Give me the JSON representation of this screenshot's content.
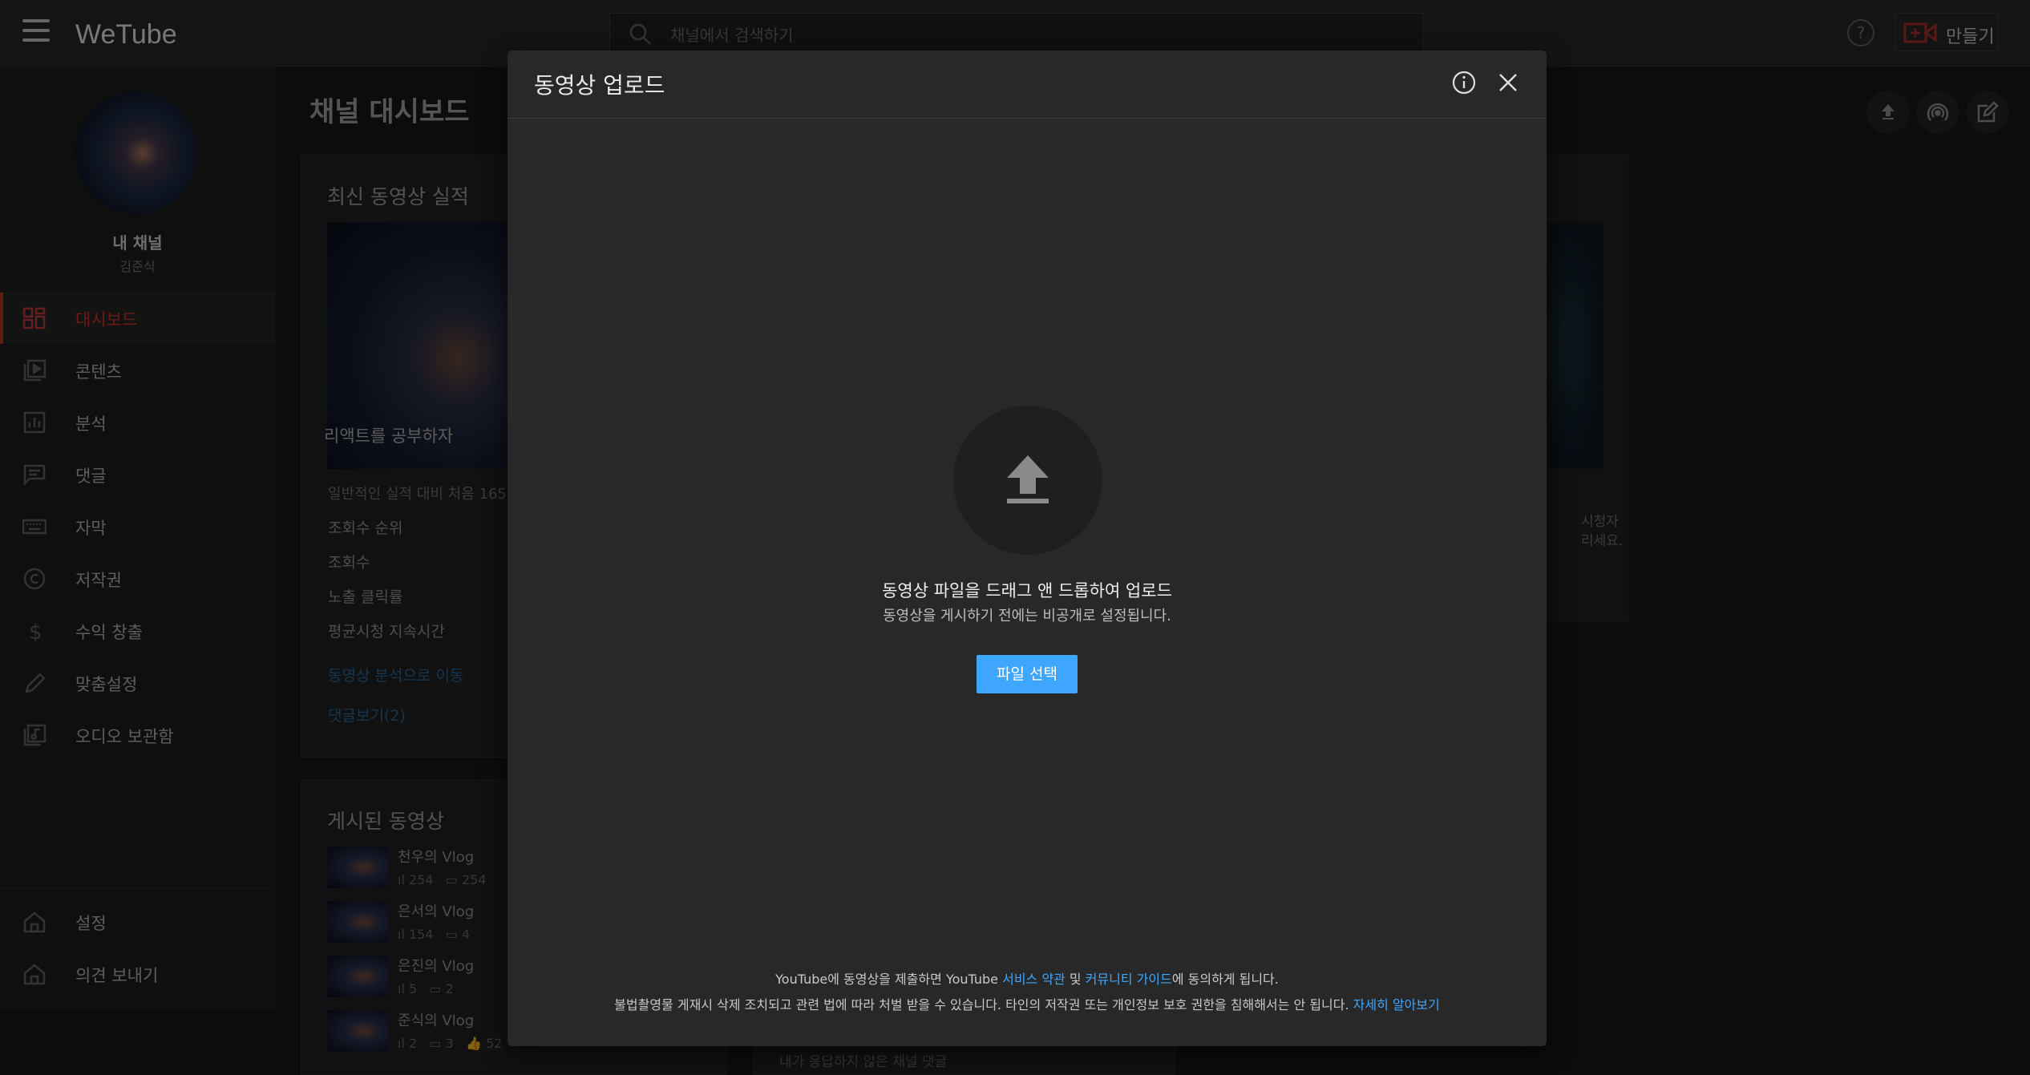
{
  "app": {
    "logo": "WeTube"
  },
  "search": {
    "placeholder": "채널에서 검색하기"
  },
  "header": {
    "help_icon": "?",
    "create_label": "만들기"
  },
  "sidebar": {
    "channel_name": "내 채널",
    "channel_user": "김준식",
    "items": [
      {
        "label": "대시보드",
        "icon": "dashboard-icon",
        "active": true
      },
      {
        "label": "콘텐츠",
        "icon": "content-icon"
      },
      {
        "label": "분석",
        "icon": "analytics-icon"
      },
      {
        "label": "댓글",
        "icon": "comment-icon"
      },
      {
        "label": "자막",
        "icon": "subtitles-icon"
      },
      {
        "label": "저작권",
        "icon": "copyright-icon"
      },
      {
        "label": "수익 창출",
        "icon": "dollar-icon"
      },
      {
        "label": "맞춤설정",
        "icon": "pencil-icon"
      },
      {
        "label": "오디오 보관함",
        "icon": "audio-library-icon"
      }
    ],
    "bottom_items": [
      {
        "label": "설정",
        "icon": "settings-icon"
      },
      {
        "label": "의견 보내기",
        "icon": "feedback-icon"
      }
    ]
  },
  "dashboard": {
    "title": "채널 대시보드",
    "latest": {
      "title": "최신 동영상 실적",
      "video_caption": "리액트를 공부하자",
      "note": "일반적인 실적 대비 처음 165",
      "rows": [
        "조회수 순위",
        "조회수",
        "노출 클릭률",
        "평균시청 지속시간"
      ],
      "analytics_link": "동영상 분석으로 이동",
      "comments_link": "댓글보기(2)"
    },
    "right_card_text": [
      "시청자",
      "리세요."
    ],
    "published": {
      "title": "게시된 동영상",
      "videos": [
        {
          "title": "천우의 Vlog",
          "views": "254",
          "comments": "254",
          "likes": ""
        },
        {
          "title": "은서의 Vlog",
          "views": "154",
          "comments": "4",
          "likes": ""
        },
        {
          "title": "은진의 Vlog",
          "views": "5",
          "comments": "2",
          "likes": ""
        },
        {
          "title": "준식의 Vlog",
          "views": "2",
          "comments": "3",
          "likes": "52"
        }
      ]
    },
    "unanswered_comments": "내가 응답하지 않은 채널 댓글"
  },
  "modal": {
    "title": "동영상 업로드",
    "drop_title": "동영상 파일을 드래그 앤 드롭하여 업로드",
    "drop_subtitle": "동영상을 게시하기 전에는 비공개로 설정됩니다.",
    "file_button": "파일 선택",
    "footer1_pre": "YouTube에 동영상을 제출하면 YouTube ",
    "footer1_terms": "서비스 약관",
    "footer1_mid": " 및 ",
    "footer1_guide": "커뮤니티 가이드",
    "footer1_post": "에 동의하게 됩니다.",
    "footer2_pre": "불법촬영물 게재시 삭제 조치되고 관련 법에 따라 처벌 받을 수 있습니다. 타인의 저작권 또는 개인정보 보호 권한을 침해해서는 안 됩니다. ",
    "footer2_link": "자세히 알아보기"
  },
  "colors": {
    "accent": "#3ea6ff",
    "active_nav": "#dd3333",
    "modal_bg": "#282828"
  }
}
